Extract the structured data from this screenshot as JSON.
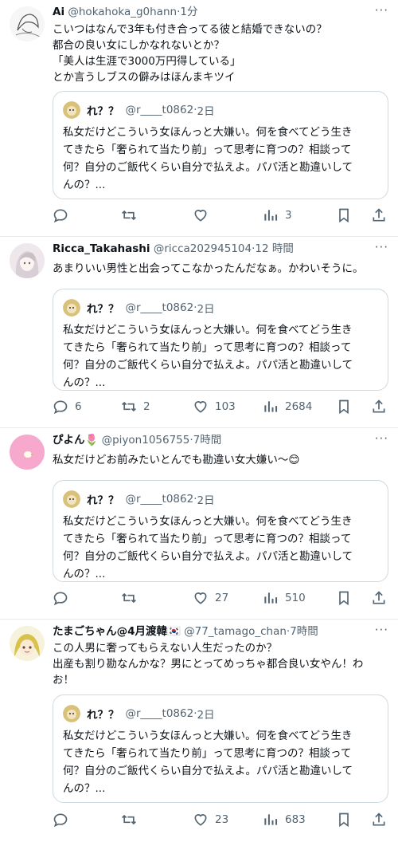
{
  "quoted": {
    "name": "れ？？",
    "handle": "@r____t0862",
    "time": "2日",
    "lines": [
      "私女だけどこういう女ほんっと大嫌い。何を食べてどう生き",
      "てきたら「奢られて当たり前」って思考に育つの？相談って",
      "何？自分のご飯代くらい自分で払えよ。パパ活と勘違いして",
      "んの？..."
    ]
  },
  "tweets": [
    {
      "name": "Ai",
      "handle": "@hokahoka_g0hann",
      "time": "1分",
      "lines": [
        "こいつはなんで3年も付き合ってる彼と結婚できないの？",
        "都合の良い女にしかなれないとか？",
        "「美人は生涯で3000万円得している」",
        "とか言うしブスの僻みはほんまキツイ"
      ],
      "reply_count": "",
      "retweet_count": "",
      "like_count": "",
      "view_count": "3"
    },
    {
      "name": "Ricca_Takahashi",
      "handle": "@ricca202945104",
      "time": "12 時間",
      "lines": [
        "あまりいい男性と出会ってこなかったんだなぁ。かわいそうに。"
      ],
      "reply_count": "6",
      "retweet_count": "2",
      "like_count": "103",
      "view_count": "2684"
    },
    {
      "name": "ぴよん🌷",
      "handle": "@piyon1056755",
      "time": "7時間",
      "lines": [
        "私女だけどお前みたいとんでも勘違い女大嫌い〜😊"
      ],
      "reply_count": "",
      "retweet_count": "",
      "like_count": "27",
      "view_count": "510"
    },
    {
      "name": "たまごちゃん@4月渡韓🇰🇷",
      "handle": "@77_tamago_chan",
      "time": "7時間",
      "lines": [
        "この人男に奢ってもらえない人生だったのか？",
        "出産も割り勘なんかな？男にとってめっちゃ都合良い女やん！わ",
        "お！"
      ],
      "reply_count": "",
      "retweet_count": "",
      "like_count": "23",
      "view_count": "683"
    }
  ],
  "ui": {
    "more": "···",
    "dot": "·"
  },
  "icons": [
    "more-icon",
    "reply-icon",
    "retweet-icon",
    "like-icon",
    "views-icon",
    "bookmark-icon",
    "share-icon"
  ],
  "colors": {
    "text": "#0f1419",
    "secondary": "#536471",
    "border": "#cfd9de",
    "divider": "#e7e9eb"
  }
}
